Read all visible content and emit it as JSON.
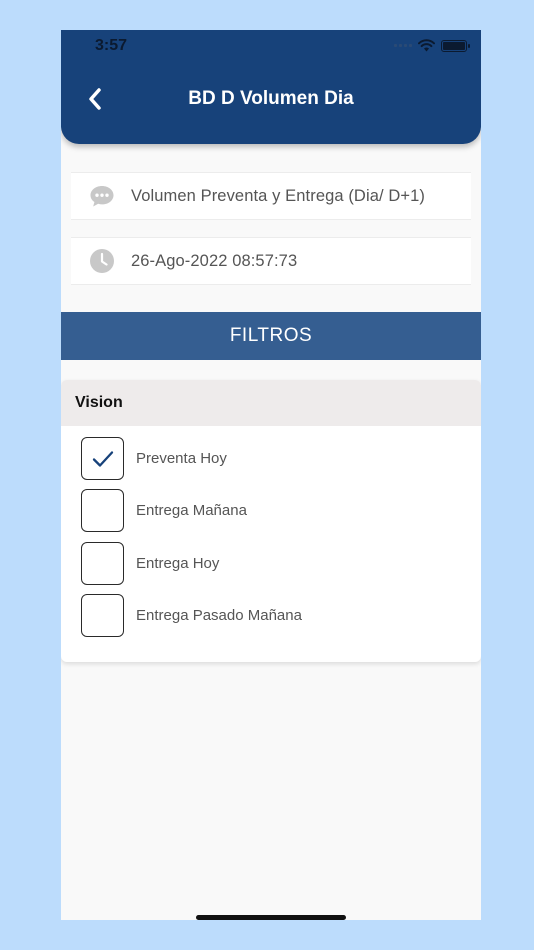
{
  "status_bar": {
    "time": "3:57"
  },
  "header": {
    "title": "BD D Volumen Dia"
  },
  "info": [
    {
      "icon": "chat-bubble-icon",
      "text": "Volumen Preventa y Entrega (Dia/ D+1)"
    },
    {
      "icon": "clock-icon",
      "text": "26-Ago-2022 08:57:73"
    }
  ],
  "filters": {
    "label": "FILTROS",
    "section_title": "Vision",
    "options": [
      {
        "label": "Preventa Hoy",
        "checked": true
      },
      {
        "label": "Entrega Mañana",
        "checked": false
      },
      {
        "label": "Entrega Hoy",
        "checked": false
      },
      {
        "label": "Entrega Pasado Mañana",
        "checked": false
      }
    ]
  },
  "colors": {
    "header_bg": "#17427a",
    "filtros_bg": "#355e91",
    "page_bg": "#bcdcfc",
    "check_color": "#17427a"
  }
}
